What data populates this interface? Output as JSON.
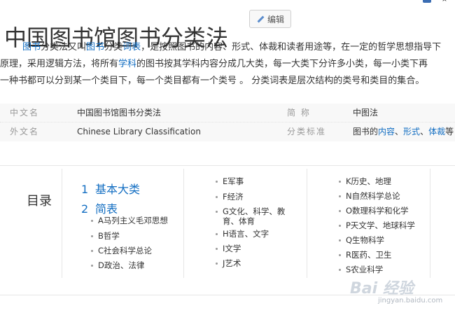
{
  "page": {
    "title": "中国图书馆图书分类法",
    "edit_label": "编辑"
  },
  "summary": {
    "line1_parts": [
      "图书",
      "分类法又叫",
      "图书",
      "分类",
      "词表",
      "，是按照图书的内容、形式、体裁和读者用途等，在一定的哲学思想指导下"
    ],
    "line2_parts": [
      "原理，采用逻辑方法，将所有",
      "学科",
      "的图书按其学科内容分成几大类，每一大类下分许多小类，每一小类下再"
    ],
    "line3": "一种书都可以分到某一个类目下，每一个类目都有一个类号 。 分类词表是层次结构的类号和类目的集合。"
  },
  "infobox": {
    "rows": [
      {
        "k1": "中文名",
        "v1": "中国图书馆图书分类法",
        "k2": "简 称",
        "v2": "中图法"
      },
      {
        "k1": "外文名",
        "v1": "Chinese Library Classification",
        "k2": "分类标准",
        "v2_parts": [
          "图书的",
          "内容",
          "、",
          "形式",
          "、",
          "体裁",
          "等"
        ]
      }
    ]
  },
  "toc": {
    "title": "目录",
    "main_items": [
      {
        "num": "1",
        "label": "基本大类"
      },
      {
        "num": "2",
        "label": "简表"
      }
    ],
    "col1_sub": [
      "A马列主义毛邓思想",
      "B哲学",
      "C社会科学总论",
      "D政治、法律"
    ],
    "col2": [
      "E军事",
      "F经济",
      "G文化、科学、教育、体育",
      "H语言、文字",
      "I文学",
      "J艺术"
    ],
    "col3": [
      "K历史、地理",
      "N自然科学总论",
      "O数理科学和化学",
      "P天文学、地球科学",
      "Q生物科学",
      "R医药、卫生",
      "S农业科学"
    ]
  },
  "watermark": {
    "text": "Bai 经验",
    "url": "jingyan.baidu.com"
  }
}
